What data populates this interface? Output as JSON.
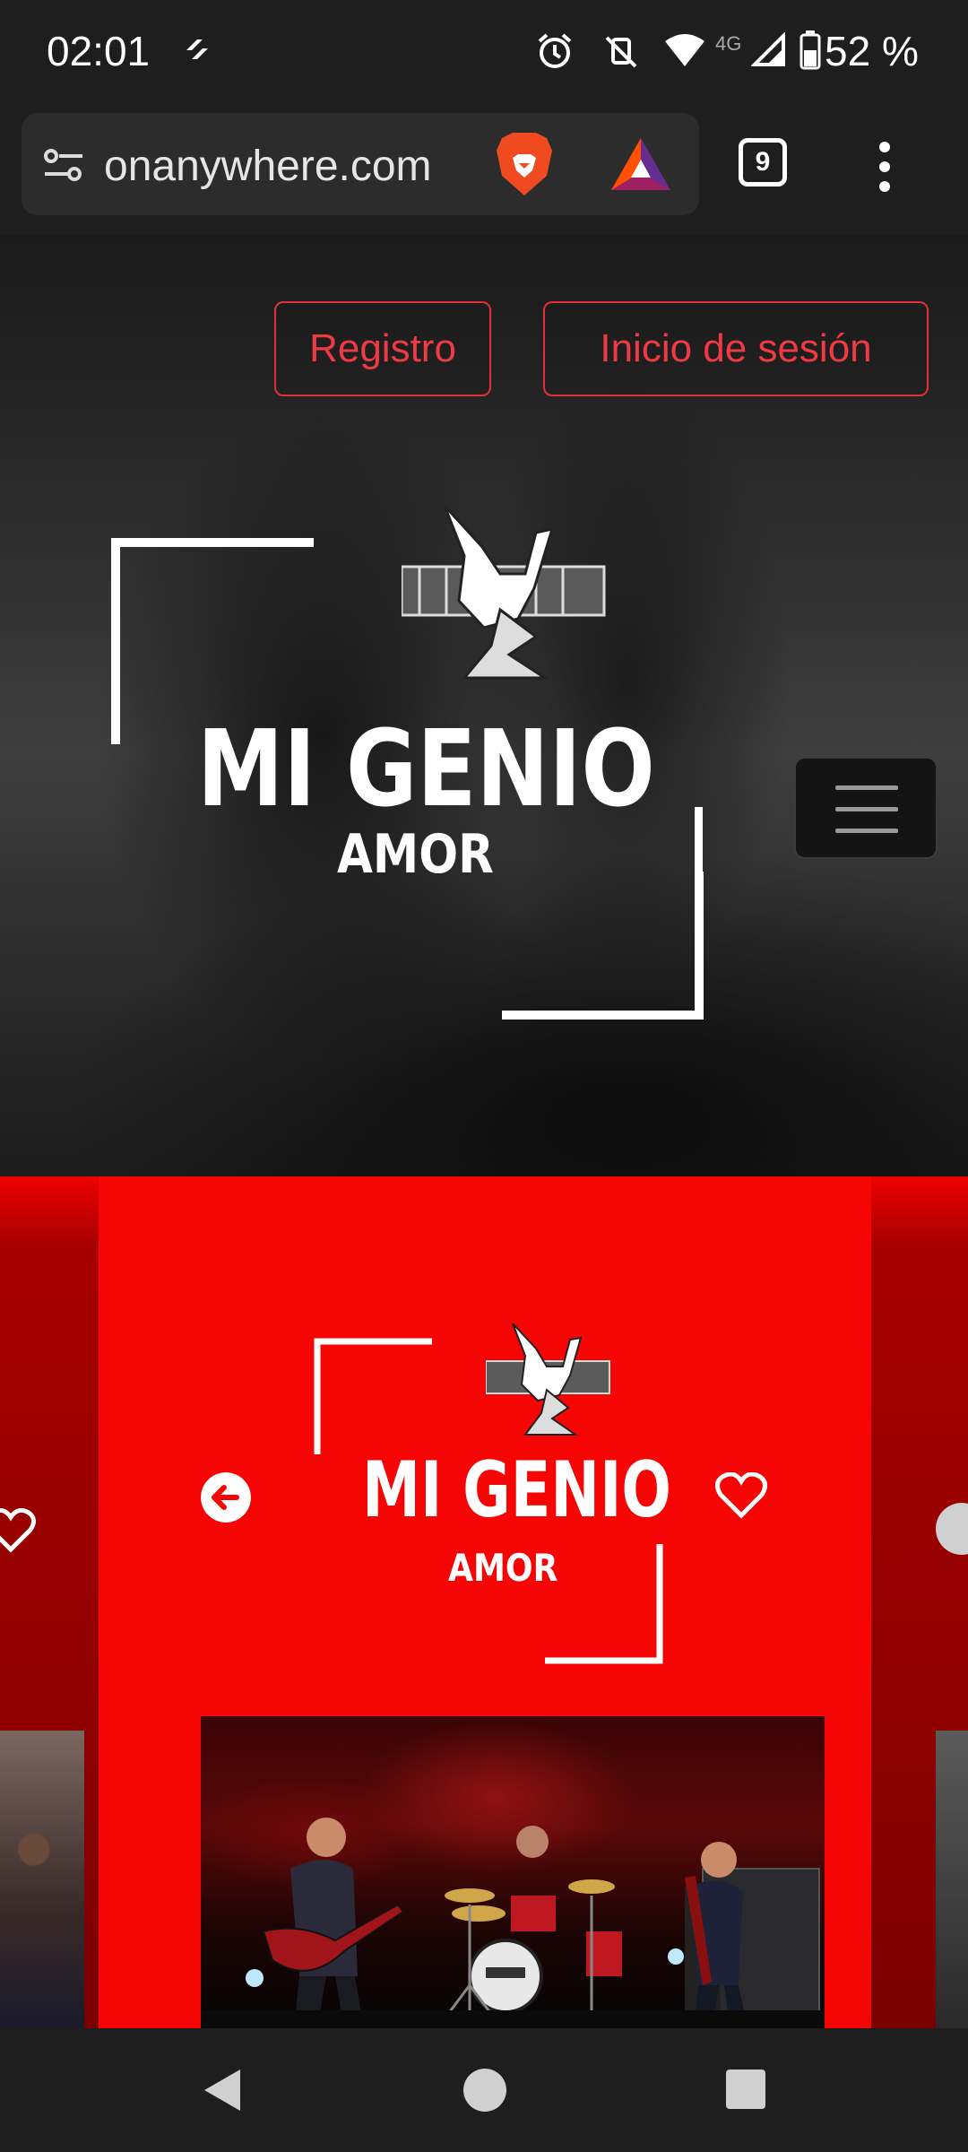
{
  "status_bar": {
    "time": "02:01",
    "network": "4G",
    "battery": "52 %"
  },
  "browser": {
    "url": "onanywhere.com",
    "tab_count": "9"
  },
  "hero": {
    "register_label": "Registro",
    "login_label": "Inicio de sesión",
    "logo_title": "MI GENIO",
    "logo_subtitle": "AMOR"
  },
  "card": {
    "logo_title": "MI GENIO",
    "logo_subtitle": "AMOR"
  },
  "colors": {
    "accent_red": "#f50605",
    "button_red": "#ee3a44",
    "dark": "#1e1e1e"
  },
  "icons": [
    "filter-icon",
    "brave-lion-icon",
    "bat-triangle-icon",
    "tabs-icon",
    "more-vert-icon",
    "hamburger-menu-icon",
    "arrow-left-circle-icon",
    "heart-outline-icon",
    "back-triangle-icon",
    "home-circle-icon",
    "recents-square-icon"
  ]
}
